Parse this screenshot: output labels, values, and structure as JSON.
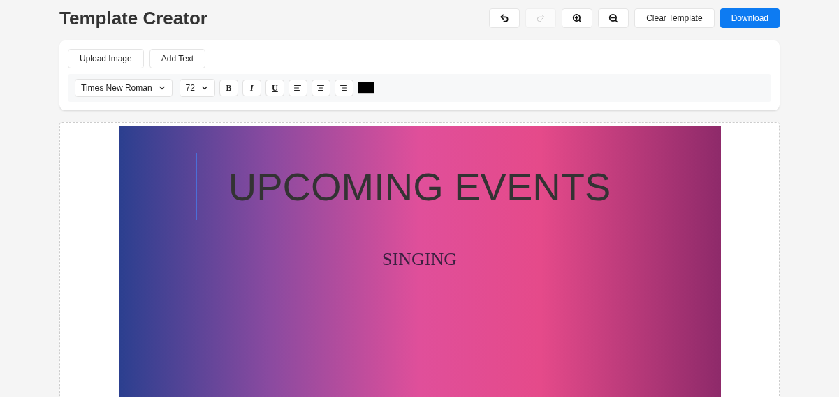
{
  "header": {
    "title": "Template Creator",
    "tools": [
      {
        "kind": "undo",
        "disabled": false
      },
      {
        "kind": "redo",
        "disabled": true
      },
      {
        "kind": "zoom-in",
        "disabled": false
      },
      {
        "kind": "zoom-out",
        "disabled": false
      }
    ],
    "clear_button": "Clear Template",
    "download_button": "Download"
  },
  "toolbar": {
    "actions": [
      "Upload Image",
      "Add Text"
    ],
    "font_family": "Times New Roman",
    "font_size": "72",
    "format_buttons": [
      {
        "kind": "bold",
        "label": "B"
      },
      {
        "kind": "italic",
        "label": "I"
      },
      {
        "kind": "underline",
        "label": "U"
      },
      {
        "kind": "align-left"
      },
      {
        "kind": "align-center"
      },
      {
        "kind": "align-right"
      }
    ],
    "text_color": {
      "color": "#000000"
    }
  },
  "canvas": {
    "layers": [
      {
        "kind": "heading",
        "text": "UPCOMING EVENTS",
        "selected": true
      },
      {
        "kind": "subheading",
        "text": "SINGING",
        "selected": false
      }
    ]
  }
}
